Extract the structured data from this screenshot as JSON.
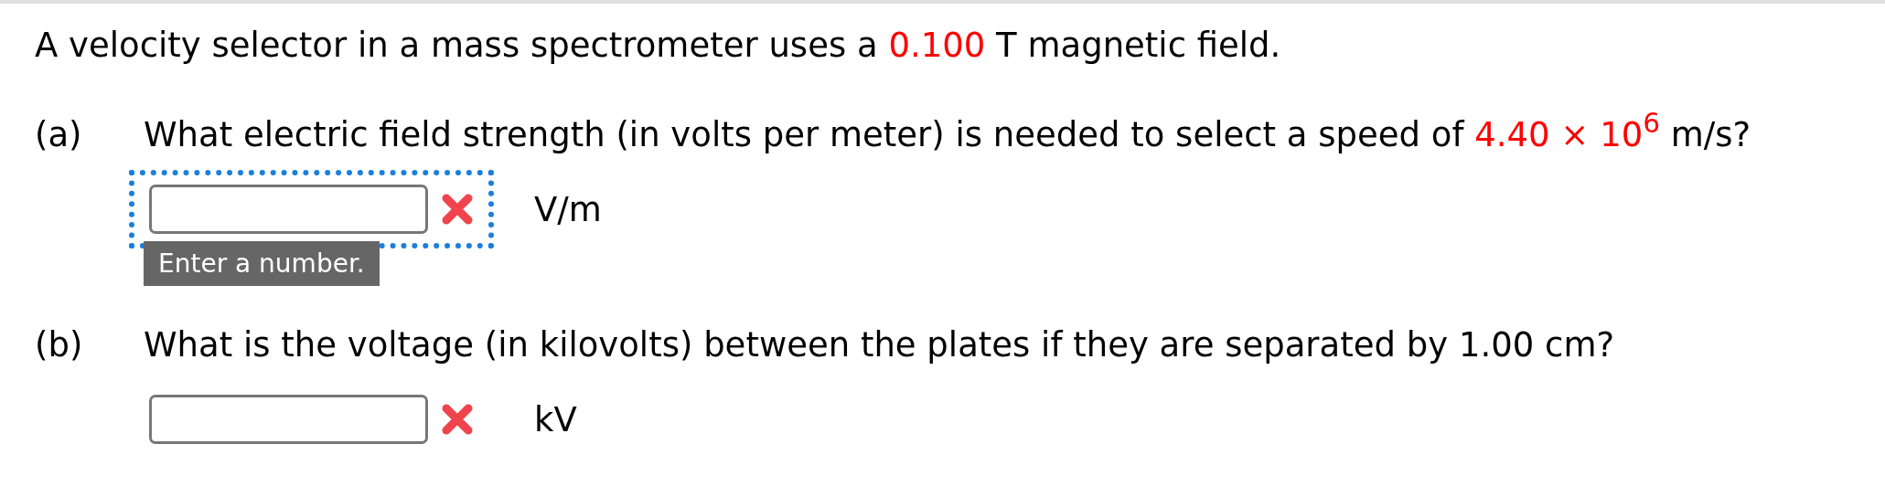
{
  "intro": [
    {
      "text": "A velocity selector in a mass spectrometer uses a ",
      "highlight": false
    },
    {
      "text": "0.100",
      "highlight": true
    },
    {
      "text": " T magnetic field.",
      "highlight": false
    }
  ],
  "questions": [
    {
      "label": "(a)",
      "parts": [
        {
          "text": "What electric field strength (in volts per meter) is needed to select a speed of ",
          "highlight": false
        },
        {
          "text": "4.40 × 10$^{6}$",
          "highlight": true
        },
        {
          "text": " m/s?",
          "highlight": false
        }
      ],
      "focused": true,
      "correct": false,
      "unit": "V/m",
      "tooltip": "Enter a number."
    },
    {
      "label": "(b)",
      "parts": [
        {
          "text": "What is the voltage (in kilovolts) between the plates if they are separated by 1.00 cm?",
          "highlight": false
        }
      ],
      "focused": false,
      "correct": false,
      "unit": "kV"
    }
  ]
}
